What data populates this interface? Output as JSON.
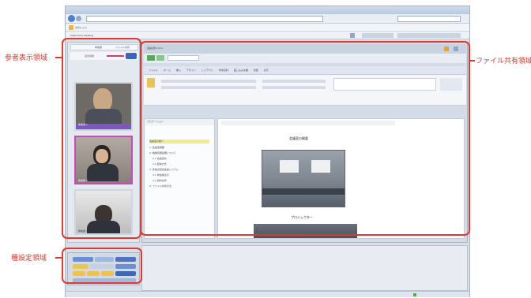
{
  "browser": {
    "url": "http://...",
    "tab_label": "Multi-Party Meeting",
    "favorites_label": "お気に入り"
  },
  "left_panel": {
    "tab_active": "参加者",
    "tab_other": "ファイル共有",
    "control_label": "表示切替",
    "participants": [
      {
        "name": "参加者 1",
        "selected": false
      },
      {
        "name": "参加者 2",
        "selected": true
      },
      {
        "name": "参加者 3",
        "selected": false
      }
    ]
  },
  "document": {
    "doc_title": "会議資料.docx",
    "ribbon_tabs": [
      "ファイル",
      "ホーム",
      "挿入",
      "デザイン",
      "レイアウト",
      "参考資料",
      "差し込み文書",
      "校閲",
      "表示"
    ],
    "nav_header": "ナビゲーション",
    "nav_items": [
      "会議室の紹介",
      "1. 会議室概要",
      "2. 映像音響設備について",
      "2.1 会議室内",
      "2.2 配信方式",
      "3. 多地点接続会議システム",
      "3.1 参加者表示",
      "3.2 資料共有",
      "4. ファイル共有方法"
    ],
    "page_heading": "会議室の概要",
    "caption1": "会議室全景",
    "caption2": "プロジェクター"
  },
  "annotations": {
    "participants_area": "参者表示領域",
    "file_share_area": "ファイル共有領域",
    "settings_area": "種設定領域"
  },
  "colors": {
    "annotation": "#e0392f",
    "selection": "#c64bb8",
    "video_bar": "#7d56c4"
  }
}
